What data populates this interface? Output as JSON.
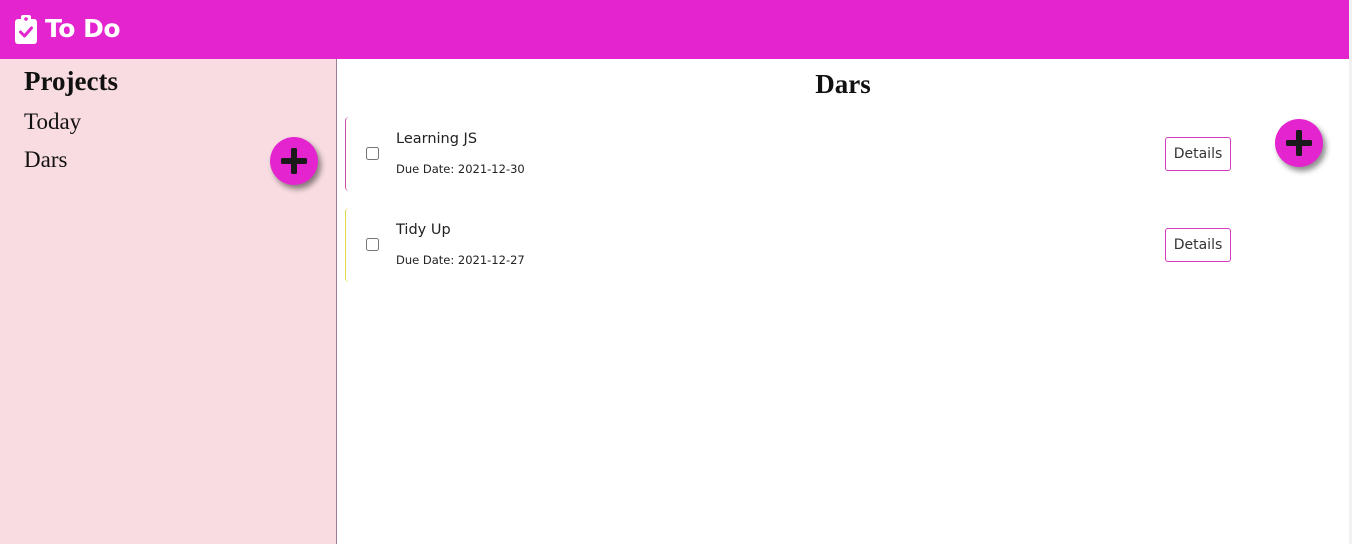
{
  "header": {
    "title": "To Do",
    "icon": "clipboard-check-icon",
    "color": "#e424cf"
  },
  "sidebar": {
    "heading": "Projects",
    "items": [
      {
        "label": "Today"
      },
      {
        "label": "Dars"
      }
    ],
    "add_button_icon": "plus-icon",
    "background": "#f8dce1"
  },
  "main": {
    "project_title": "Dars",
    "add_button_icon": "plus-icon",
    "tasks": [
      {
        "title": "Learning JS",
        "due": "Due Date: 2021-12-30",
        "done": false,
        "details_label": "Details",
        "priority_color": "#c94ea0"
      },
      {
        "title": "Tidy Up",
        "due": "Due Date: 2021-12-27",
        "done": false,
        "details_label": "Details",
        "priority_color": "#e7d84a"
      }
    ]
  }
}
